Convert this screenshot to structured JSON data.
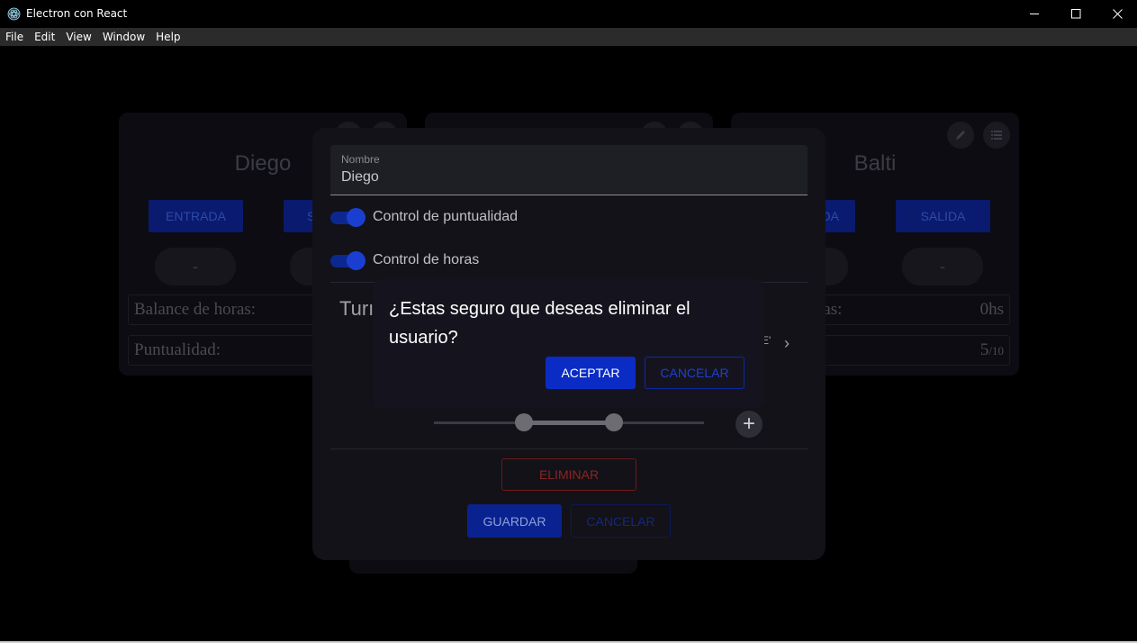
{
  "window": {
    "title": "Electron con React",
    "minimize": "—",
    "maximize": "☐",
    "close": "✕"
  },
  "menu": [
    "File",
    "Edit",
    "View",
    "Window",
    "Help"
  ],
  "cards": {
    "left": {
      "name": "Diego",
      "entrada": "ENTRADA",
      "salida_partial": "S",
      "pill1": "-",
      "balance_label": "Balance de horas:",
      "puntualidad_label": "Puntualidad:"
    },
    "right": {
      "name": "Balti",
      "entrada_partial": "DA",
      "salida": "SALIDA",
      "pill2": "-",
      "balance_label_partial": "horas:",
      "balance_value": "0hs",
      "puntualidad_label_partial": "d:",
      "puntualidad_value": "5",
      "puntualidad_max": "/10"
    }
  },
  "edit_modal": {
    "name_label": "Nombre",
    "name_value": "Diego",
    "switch1_label": "Control de puntualidad",
    "switch2_label": "Control de horas",
    "turnos_title_partial": "Turı",
    "chevron_text": "E'",
    "plus": "+",
    "delete_label": "ELIMINAR",
    "save_label": "GUARDAR",
    "cancel_label": "CANCELAR"
  },
  "confirm_dialog": {
    "message": "¿Estas seguro que deseas eliminar el usuario?",
    "accept_label": "ACEPTAR",
    "cancel_label": "CANCELAR"
  }
}
